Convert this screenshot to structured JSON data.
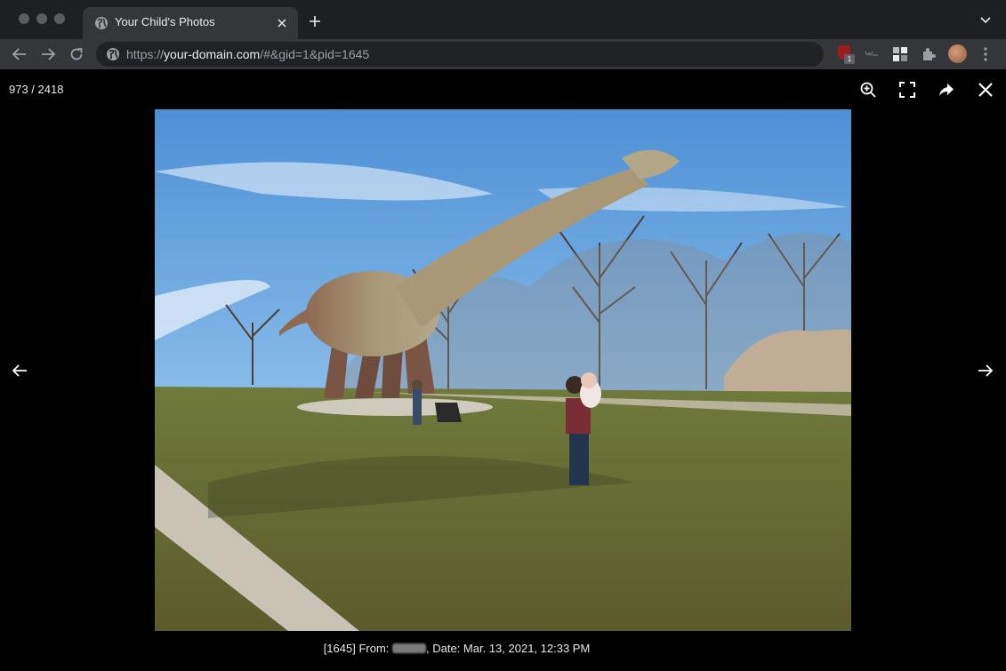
{
  "browser": {
    "tab_title": "Your Child's Photos",
    "url_scheme": "https://",
    "url_host": "your-domain.com",
    "url_path": "/#&gid=1&pid=1645",
    "extension_badge": "1"
  },
  "viewer": {
    "counter": "973 / 2418",
    "caption_prefix": "[1645] From:",
    "caption_suffix": ", Date: Mar. 13, 2021, 12:33 PM"
  },
  "icons": {
    "tab": [
      "globe-icon",
      "close-icon",
      "plus-icon",
      "chevron-down-icon"
    ],
    "toolbar": [
      "back-arrow-icon",
      "forward-arrow-icon",
      "reload-icon",
      "globe-icon",
      "ublock-icon",
      "extension-icon",
      "grid-icon",
      "puzzle-icon",
      "avatar",
      "kebab-menu-icon"
    ],
    "viewer": [
      "zoom-in-icon",
      "fullscreen-icon",
      "share-icon",
      "close-icon",
      "previous-arrow-icon",
      "next-arrow-icon"
    ]
  },
  "colors": {
    "tabstrip": "#1e1f22",
    "toolbar": "#35363a",
    "omnibox": "#202124",
    "viewer_bg": "#000000"
  }
}
